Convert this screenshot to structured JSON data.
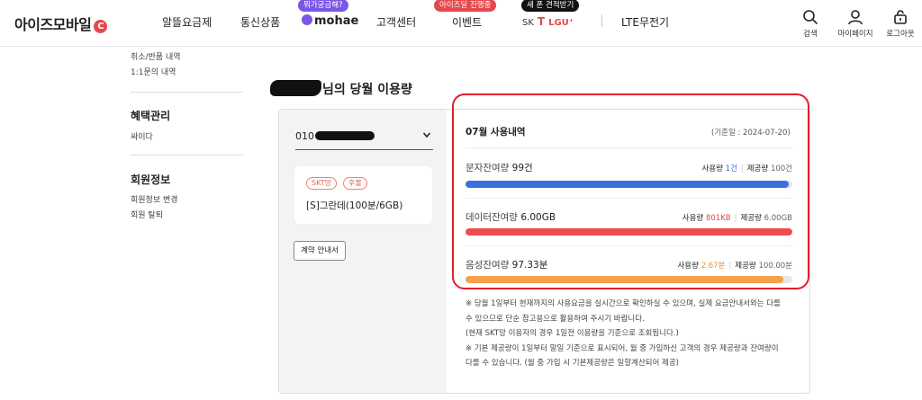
{
  "header": {
    "logo": "아이즈모바일",
    "logo_mark": "C",
    "nav": [
      {
        "label": "알뜰요금제"
      },
      {
        "label": "통신상품"
      },
      {
        "label": "mohae",
        "badge": "뭐가궁금해?"
      },
      {
        "label": "고객센터"
      },
      {
        "label": "이벤트",
        "badge": "아이즈딜 진행중"
      },
      {
        "label": "LTE무전기"
      }
    ],
    "carriers": {
      "badge": "새 폰 견적받기",
      "skt": "SK",
      "t": "T",
      "lgu": "LGU⁺"
    },
    "utility": [
      {
        "label": "검색",
        "icon": "search-icon"
      },
      {
        "label": "마이페이지",
        "icon": "user-icon"
      },
      {
        "label": "로그아웃",
        "icon": "logout-icon"
      }
    ],
    "colors": {
      "badge_purple": "#7a57e6",
      "badge_red": "#e5484d",
      "badge_black": "#111111"
    }
  },
  "sidebar": {
    "top_links": [
      "취소/반품 내역",
      "1:1문의 내역"
    ],
    "sections": [
      {
        "heading": "혜택관리",
        "links": [
          "싸이다"
        ]
      },
      {
        "heading": "회원정보",
        "links": [
          "회원정보 변경",
          "회원 탈퇴"
        ]
      }
    ]
  },
  "main": {
    "title_suffix": "님의 당월 이용량",
    "phone_prefix": "010",
    "plan": {
      "badges": [
        "SKT망",
        "후불"
      ],
      "name": "[S]그란데(100분/6GB)"
    },
    "contract_button": "계약 안내서",
    "usage": {
      "month_title": "07월 사용내역",
      "base_date": "(기준일 : 2024-07-20)",
      "rows": [
        {
          "label": "문자잔여량",
          "remaining": "99건",
          "used_label": "사용량",
          "used": "1건",
          "provided_label": "제공량",
          "provided": "100건",
          "used_fraction": 0.01,
          "color": "#3b6fe0"
        },
        {
          "label": "데이터잔여량",
          "remaining": "6.00GB",
          "used_label": "사용량",
          "used": "801KB",
          "provided_label": "제공량",
          "provided": "6.00GB",
          "used_fraction": 0.0001,
          "color": "#ef4c50"
        },
        {
          "label": "음성잔여량",
          "remaining": "97.33분",
          "used_label": "사용량",
          "used": "2.67분",
          "provided_label": "제공량",
          "provided": "100.00분",
          "used_fraction": 0.027,
          "color": "#f5a04a"
        }
      ]
    },
    "notes": [
      "※ 당월 1일부터 현재까지의 사용요금을 실시간으로 확인하실 수 있으며, 실제 요금안내서와는 다를",
      "수 있으므로 단순 참고용으로 활용하여 주시기 바랍니다.",
      "(현재 SKT망 이용자의 경우 1일전 이용량을 기준으로 조회됩니다.)",
      "※ 기본 제공량이 1일부터 말일 기준으로 표시되어, 월 중 가입하신 고객의 경우 제공량과 잔여량이",
      "다를 수 있습니다. (월 중 가입 시 기본제공량은 일할계산되어 제공)"
    ]
  }
}
